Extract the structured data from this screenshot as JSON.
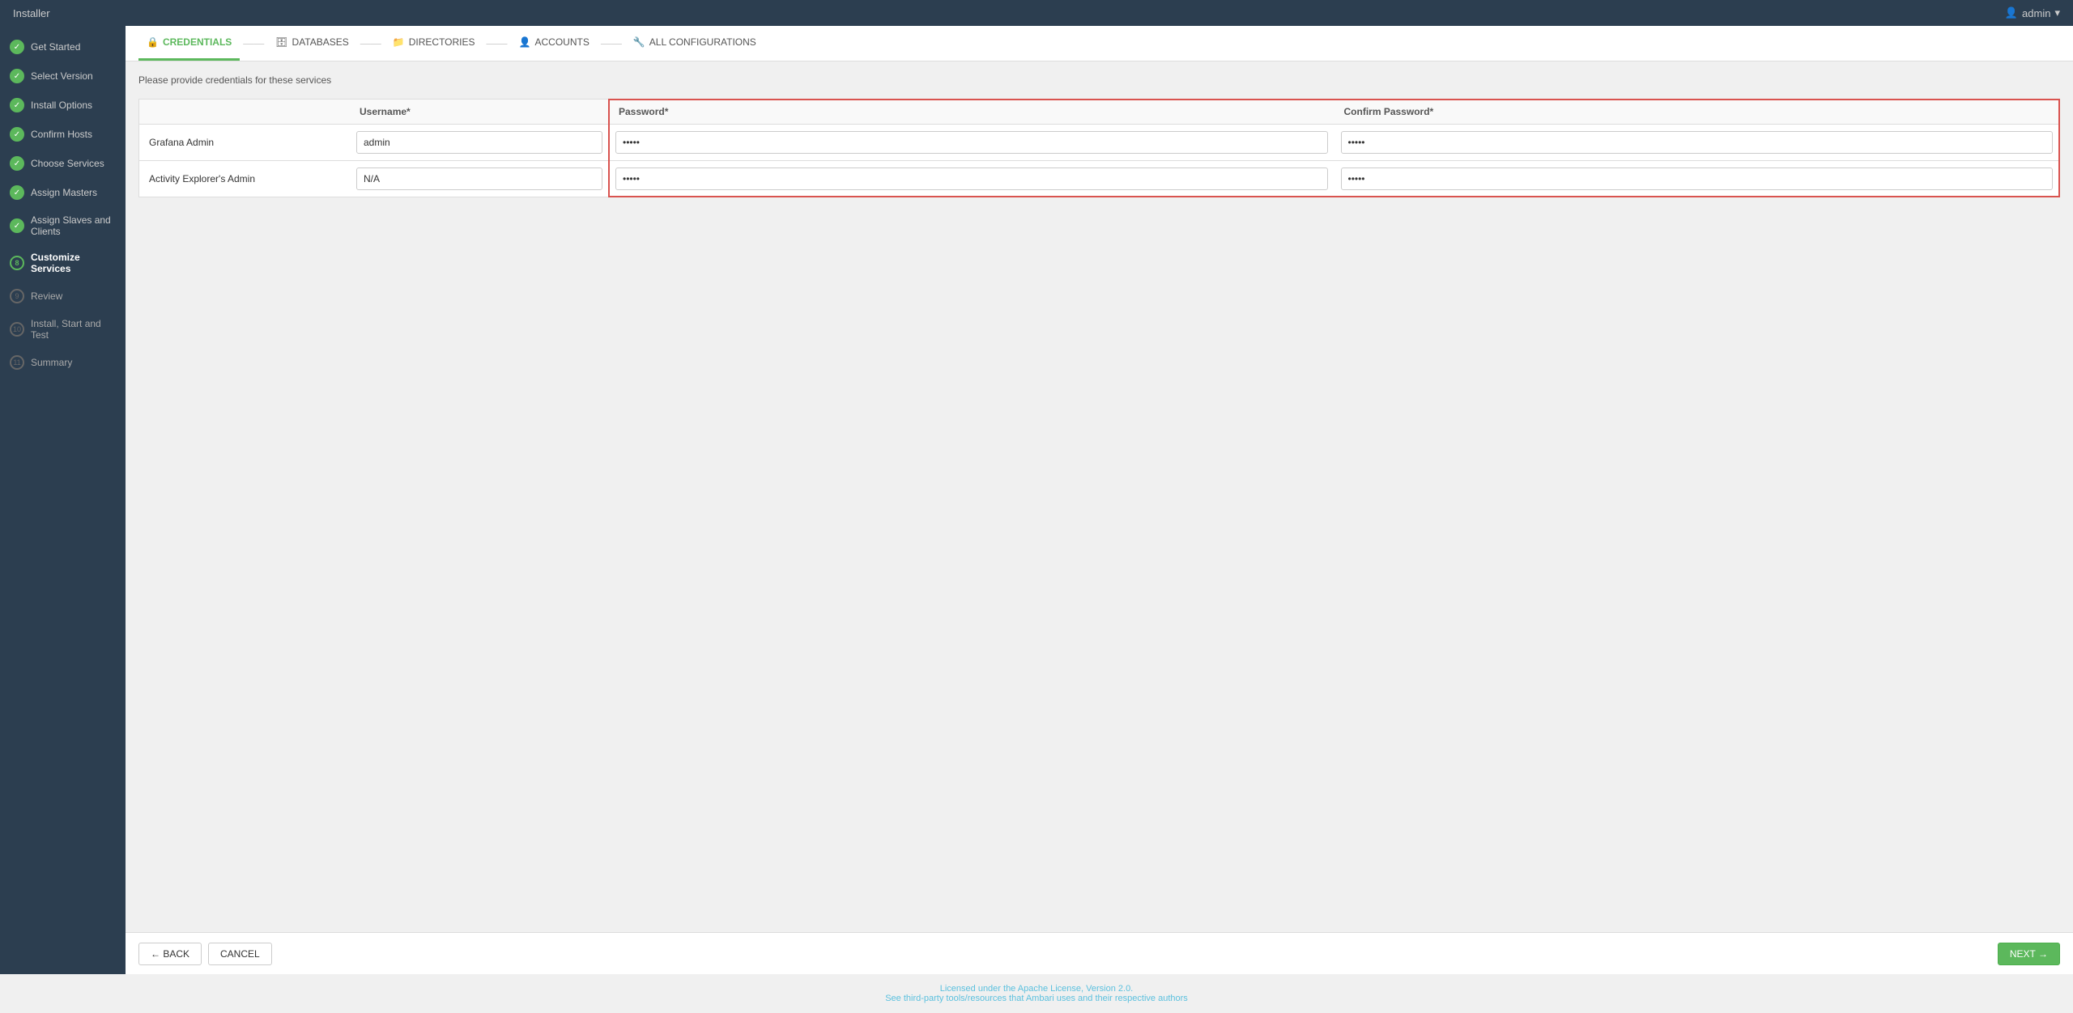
{
  "topbar": {
    "title": "Installer",
    "user_label": "admin",
    "user_icon": "👤"
  },
  "sidebar": {
    "items": [
      {
        "id": "get-started",
        "label": "Get Started",
        "state": "done",
        "number": "1"
      },
      {
        "id": "select-version",
        "label": "Select Version",
        "state": "done",
        "number": "2"
      },
      {
        "id": "install-options",
        "label": "Install Options",
        "state": "done",
        "number": "3"
      },
      {
        "id": "confirm-hosts",
        "label": "Confirm Hosts",
        "state": "done",
        "number": "4"
      },
      {
        "id": "choose-services",
        "label": "Choose Services",
        "state": "done",
        "number": "5"
      },
      {
        "id": "assign-masters",
        "label": "Assign Masters",
        "state": "done",
        "number": "6"
      },
      {
        "id": "assign-slaves",
        "label": "Assign Slaves and Clients",
        "state": "done",
        "number": "7"
      },
      {
        "id": "customize-services",
        "label": "Customize Services",
        "state": "active",
        "number": "8"
      },
      {
        "id": "review",
        "label": "Review",
        "state": "pending",
        "number": "9"
      },
      {
        "id": "install-start-test",
        "label": "Install, Start and Test",
        "state": "pending",
        "number": "10"
      },
      {
        "id": "summary",
        "label": "Summary",
        "state": "pending",
        "number": "11"
      }
    ]
  },
  "tabs": [
    {
      "id": "credentials",
      "label": "CREDENTIALS",
      "icon": "🔒",
      "active": true
    },
    {
      "id": "databases",
      "label": "DATABASES",
      "icon": "🗄",
      "active": false
    },
    {
      "id": "directories",
      "label": "DIRECTORIES",
      "icon": "📁",
      "active": false
    },
    {
      "id": "accounts",
      "label": "ACCOUNTS",
      "icon": "👤",
      "active": false
    },
    {
      "id": "all-configurations",
      "label": "ALL CONFIGURATIONS",
      "icon": "🔧",
      "active": false
    }
  ],
  "form": {
    "description": "Please provide credentials for these services",
    "col_headers": {
      "service": "",
      "username": "Username*",
      "password": "Password*",
      "confirm_password": "Confirm Password*"
    },
    "rows": [
      {
        "service": "Grafana Admin",
        "username": "admin",
        "password": "•••••",
        "confirm_password": "•••••"
      },
      {
        "service": "Activity Explorer's Admin",
        "username": "N/A",
        "password": "•••••",
        "confirm_password": "•••••"
      }
    ]
  },
  "buttons": {
    "back": "← BACK",
    "cancel": "CANCEL",
    "next": "NEXT →"
  },
  "footer": {
    "license_text": "Licensed under the Apache License, Version 2.0.",
    "third_party_text": "See third-party tools/resources that Ambari uses and their respective authors"
  }
}
